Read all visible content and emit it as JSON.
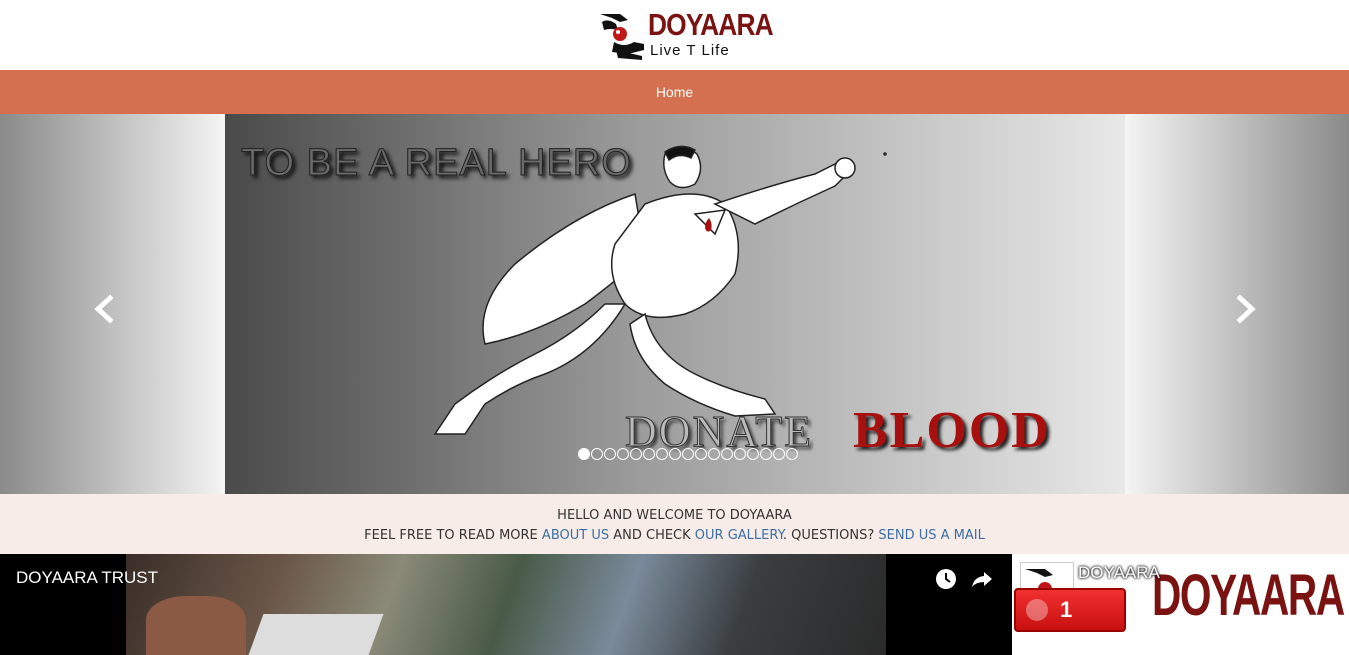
{
  "logo": {
    "name": "DOYAARA",
    "tagline": "Live T Life"
  },
  "nav": {
    "home_label": "Home"
  },
  "carousel": {
    "headline": "TO BE A REAL HERO",
    "donate": "DONATE",
    "blood": "BLOOD",
    "slide_count": 17,
    "active_index": 0
  },
  "welcome": {
    "line1": "HELLO AND WELCOME TO DOYAARA",
    "line2_prefix": "FEEL FREE TO READ MORE ",
    "about_link": "ABOUT US",
    "line2_mid": " AND CHECK ",
    "gallery_link": "OUR GALLERY",
    "line2_mid2": ". QUESTIONS? ",
    "mail_link": "SEND US A MAIL"
  },
  "video": {
    "title": "DOYAARA TRUST",
    "icons": [
      "watch-later-icon",
      "share-icon"
    ]
  },
  "facebook_widget": {
    "page_name": "DOYAARA",
    "cover_text": "DOYAARA",
    "notification_count": "1"
  },
  "colors": {
    "nav_bg": "#d4704f",
    "welcome_bg": "#f8ece8",
    "brand_red": "#7a1212",
    "link": "#3a6ea5"
  }
}
